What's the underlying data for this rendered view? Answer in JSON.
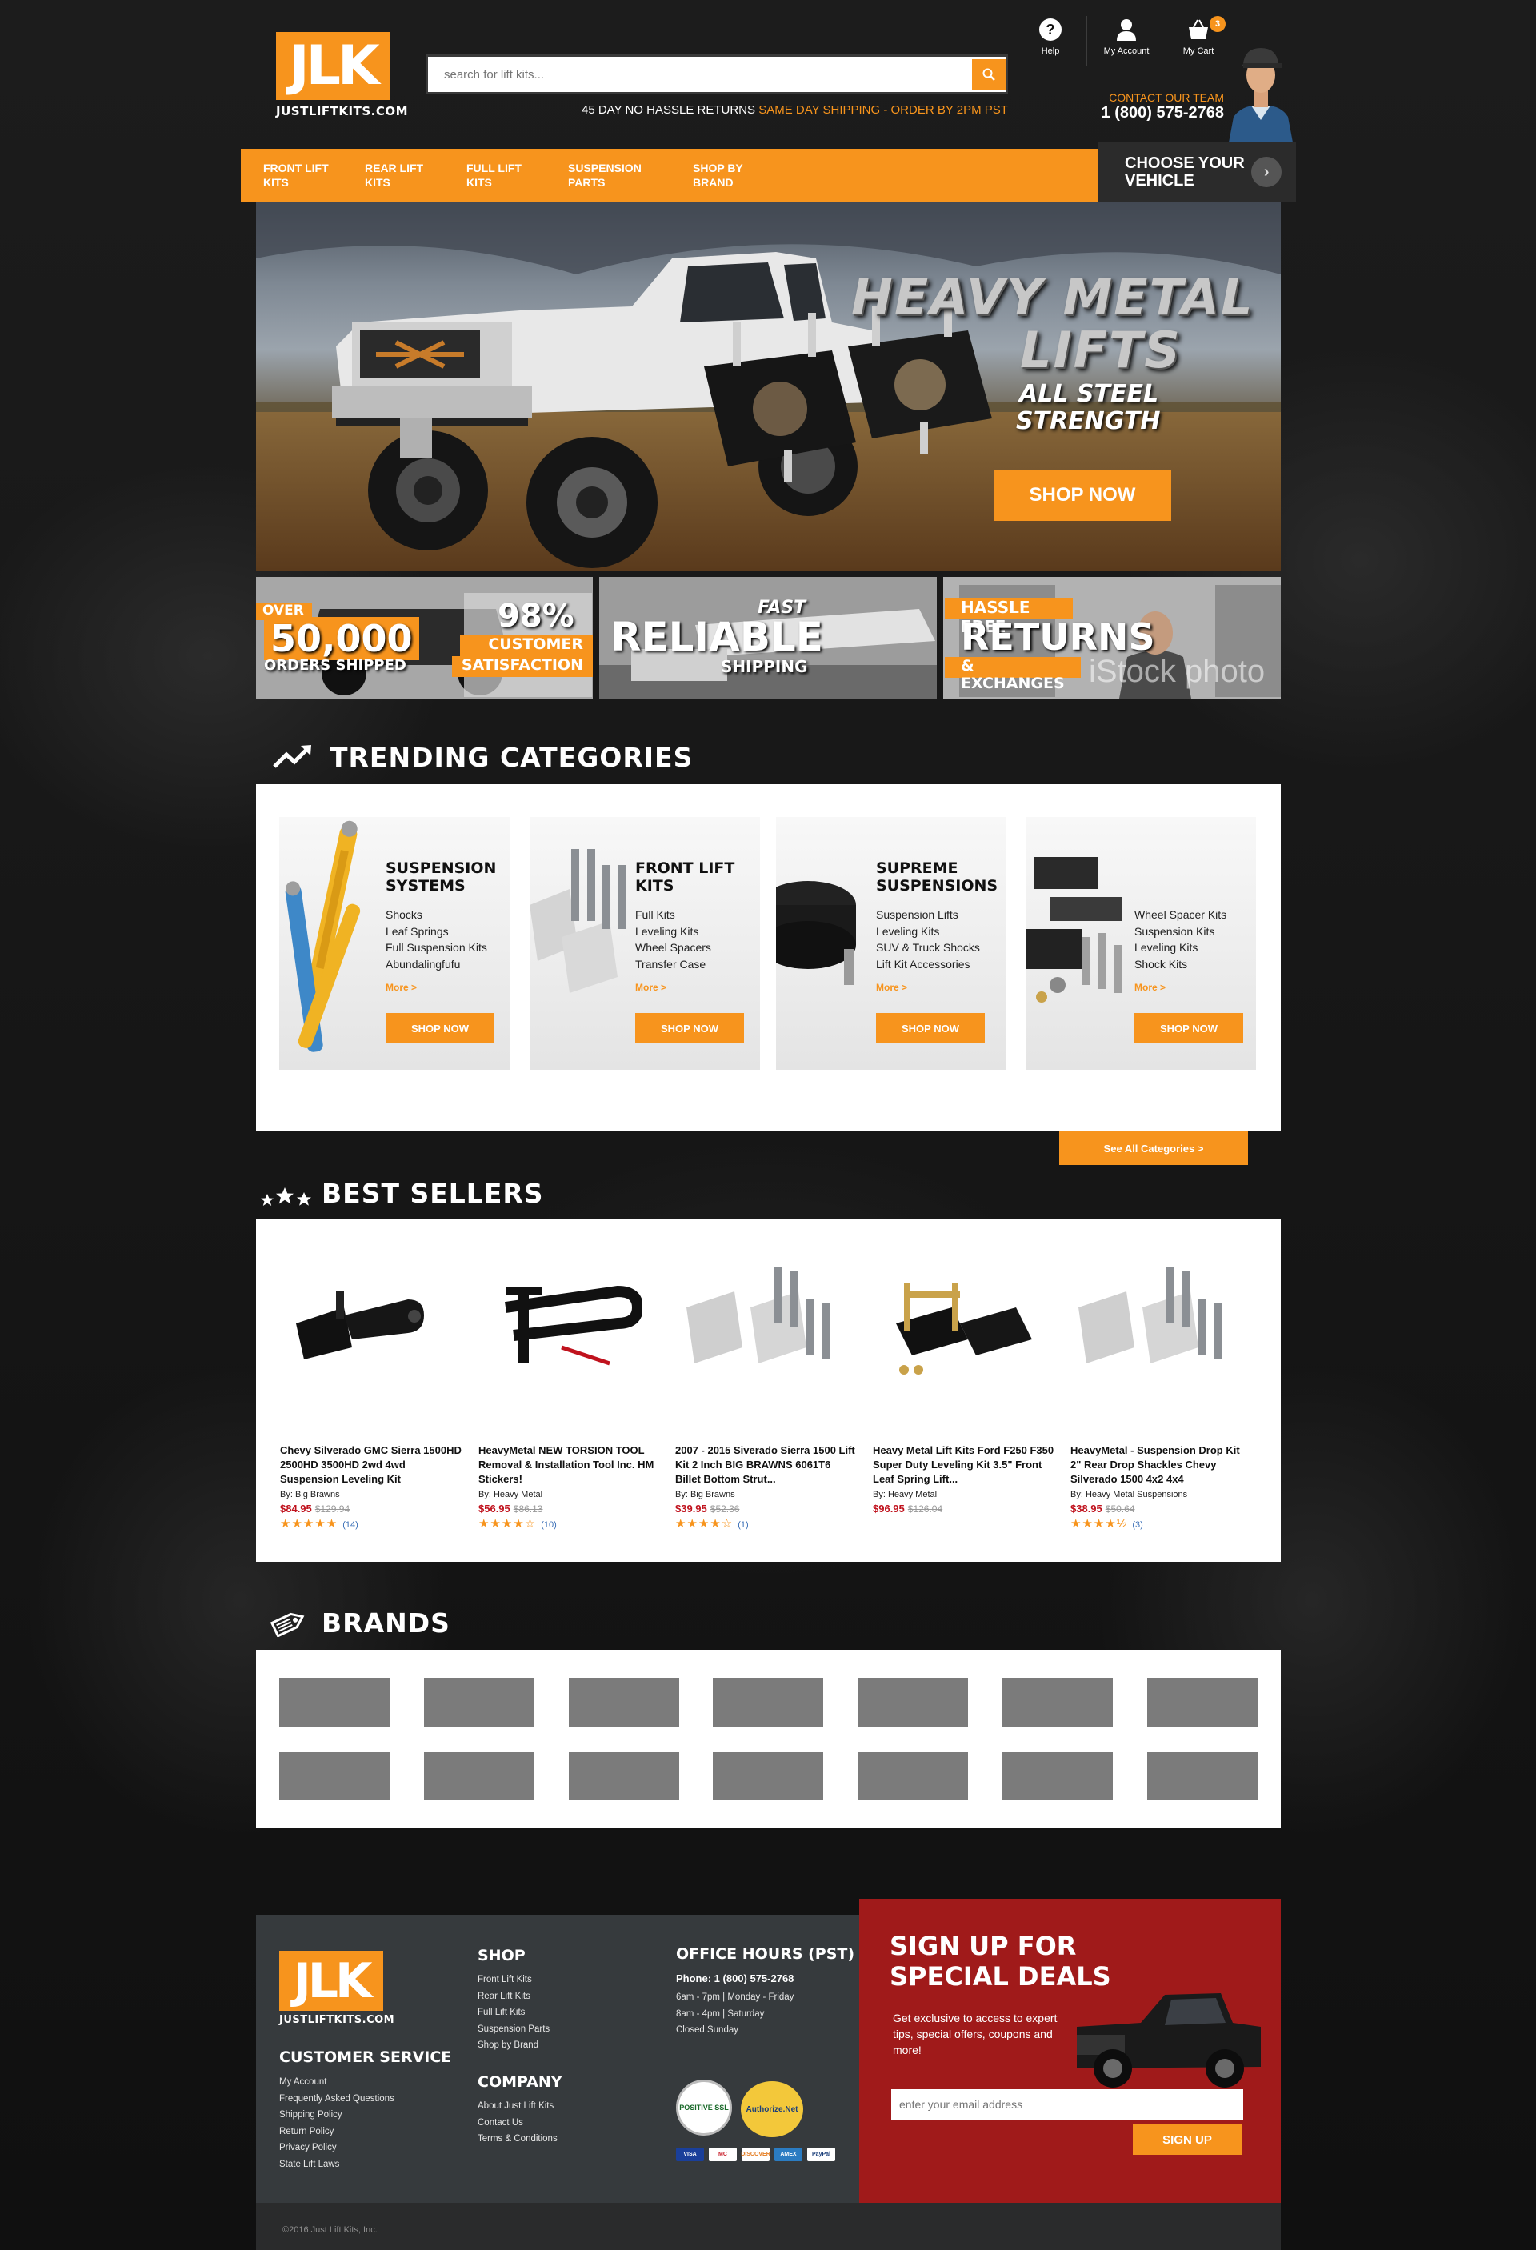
{
  "header": {
    "logo_letters": "JLK",
    "logo_text": "JUSTLIFTKITS.COM",
    "search_placeholder": "search for lift kits...",
    "promo_white": "45 DAY NO HASSLE RETURNS",
    "promo_orange": "SAME DAY SHIPPING - ORDER BY 2PM PST",
    "help_label": "Help",
    "account_label": "My Account",
    "cart_label": "My Cart",
    "cart_count": "3",
    "contact_label": "CONTACT OUR TEAM",
    "phone": "1 (800) 575-2768"
  },
  "nav": {
    "items": [
      {
        "label": "FRONT LIFT KITS"
      },
      {
        "label": "REAR LIFT KITS"
      },
      {
        "label": "FULL LIFT KITS"
      },
      {
        "label": "SUSPENSION PARTS"
      },
      {
        "label": "SHOP BY BRAND"
      }
    ],
    "vehicle_label": "CHOOSE YOUR VEHICLE"
  },
  "hero": {
    "title1": "HEAVY METAL",
    "title2": "LIFTS",
    "subtitle1": "ALL STEEL",
    "subtitle2": "STRENGTH",
    "cta": "SHOP NOW"
  },
  "promo_panels": {
    "p1_over": "OVER",
    "p1_big": "50,000",
    "p1_small": "ORDERS SHIPPED",
    "p1_pct": "98%",
    "p1_cust": "CUSTOMER",
    "p1_sat": "SATISFACTION",
    "p2_fast": "FAST",
    "p2_big": "RELIABLE",
    "p2_small": "SHIPPING",
    "p3_top": "HASSLE FREE",
    "p3_big": "RETURNS",
    "p3_small": "& EXCHANGES",
    "p3_watermark": "iStock photo"
  },
  "trending": {
    "title": "TRENDING CATEGORIES",
    "cards": [
      {
        "title": "SUSPENSION SYSTEMS",
        "items": [
          "Shocks",
          "Leaf Springs",
          "Full Suspension Kits",
          "Abundalingfufu"
        ],
        "more": "More >",
        "button": "SHOP NOW"
      },
      {
        "title": "FRONT LIFT KITS",
        "items": [
          "Full Kits",
          "Leveling Kits",
          "Wheel Spacers",
          "Transfer Case"
        ],
        "more": "More >",
        "button": "SHOP NOW"
      },
      {
        "title": "SUPREME SUSPENSIONS",
        "items": [
          "Suspension Lifts",
          "Leveling Kits",
          "SUV & Truck Shocks",
          "Lift Kit Accessories"
        ],
        "more": "More >",
        "button": "SHOP NOW"
      },
      {
        "title": "",
        "items": [
          "Wheel Spacer Kits",
          "Suspension Kits",
          "Leveling Kits",
          "Shock Kits"
        ],
        "more": "More >",
        "button": "SHOP NOW"
      }
    ],
    "see_all": "See All Categories >"
  },
  "best_sellers": {
    "title": "BEST SELLERS",
    "products": [
      {
        "name": "Chevy Silverado GMC Sierra 1500HD 2500HD 3500HD 2wd 4wd Suspension Leveling Kit",
        "by": "By: Big Brawns",
        "price": "$84.95",
        "was": "$129.94",
        "stars": "★★★★★",
        "count": "(14)",
        "rating": 5
      },
      {
        "name": "HeavyMetal NEW TORSION TOOL Removal & Installation Tool Inc. HM Stickers!",
        "by": "By: Heavy Metal",
        "price": "$56.95",
        "was": "$86.13",
        "stars": "★★★★☆",
        "count": "(10)",
        "rating": 4
      },
      {
        "name": "2007 - 2015 Siverado Sierra 1500 Lift Kit 2 Inch BIG BRAWNS 6061T6 Billet Bottom Strut...",
        "by": "By: Big Brawns",
        "price": "$39.95",
        "was": "$52.36",
        "stars": "★★★★☆",
        "count": "(1)",
        "rating": 4
      },
      {
        "name": "Heavy Metal Lift Kits Ford F250 F350 Super Duty Leveling Kit 3.5\" Front Leaf Spring Lift...",
        "by": "By: Heavy Metal",
        "price": "$96.95",
        "was": "$126.04",
        "stars": "",
        "count": "",
        "rating": 0
      },
      {
        "name": "HeavyMetal - Suspension Drop Kit 2\" Rear Drop Shackles Chevy Silverado 1500 4x2 4x4",
        "by": "By: Heavy Metal Suspensions",
        "price": "$38.95",
        "was": "$50.64",
        "stars": "★★★★½",
        "count": "(3)",
        "rating": 4.5
      }
    ]
  },
  "brands": {
    "title": "BRANDS"
  },
  "footer": {
    "logo_letters": "JLK",
    "logo_text": "JUSTLIFTKITS.COM",
    "cs_title": "CUSTOMER SERVICE",
    "cs_links": [
      "My Account",
      "Frequently Asked Questions",
      "Shipping Policy",
      "Return Policy",
      "Privacy Policy",
      "State Lift Laws"
    ],
    "shop_title": "SHOP",
    "shop_links": [
      "Front Lift Kits",
      "Rear Lift Kits",
      "Full Lift Kits",
      "Suspension Parts",
      "Shop by Brand"
    ],
    "company_title": "COMPANY",
    "company_links": [
      "About Just Lift Kits",
      "Contact Us",
      "Terms & Conditions"
    ],
    "hours_title": "OFFICE HOURS (PST)",
    "hours_phone": "Phone: 1 (800) 575-2768",
    "hours_lines": [
      "6am - 7pm | Monday - Friday",
      "8am - 4pm | Saturday",
      "Closed Sunday"
    ],
    "badge1": "POSITIVE SSL",
    "badge2": "Authorize.Net",
    "payments": [
      "VISA",
      "MC",
      "DISCOVER",
      "AMEX",
      "PayPal"
    ],
    "signup_title1": "SIGN UP FOR",
    "signup_title2": "SPECIAL DEALS",
    "signup_text": "Get exclusive to access to expert tips, special offers, coupons and more!",
    "email_placeholder": "enter your email address",
    "signup_button": "SIGN UP",
    "copyright": "©2016 Just Lift Kits, Inc."
  }
}
